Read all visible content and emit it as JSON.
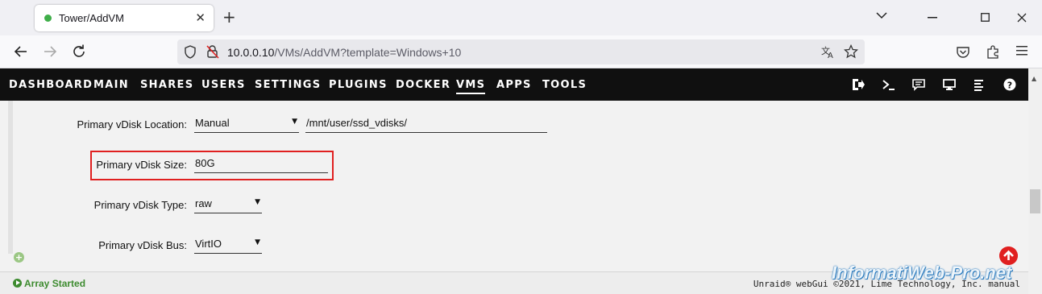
{
  "browser": {
    "tab_title": "Tower/AddVM",
    "tab_close": "✕",
    "new_tab": "+",
    "url_host": "10.0.0.10",
    "url_rest": "/VMs/AddVM?template=Windows+10"
  },
  "nav": {
    "menu": [
      "DASHBOARD",
      "MAIN",
      "SHARES",
      "USERS",
      "SETTINGS",
      "PLUGINS",
      "DOCKER",
      "VMS",
      "APPS",
      "TOOLS"
    ],
    "active": "VMS"
  },
  "form": {
    "location_label": "Primary vDisk Location:",
    "location_value": "Manual",
    "location_path": "/mnt/user/ssd_vdisks/",
    "size_label": "Primary vDisk Size:",
    "size_value": "80G",
    "type_label": "Primary vDisk Type:",
    "type_value": "raw",
    "bus_label": "Primary vDisk Bus:",
    "bus_value": "VirtIO"
  },
  "status": {
    "left": "Array Started",
    "right": "Unraid® webGui ©2021, Lime Technology, Inc. manual"
  },
  "watermark": "InformatiWeb-Pro.net",
  "colors": {
    "header_bg": "#101010",
    "highlight": "#e02020",
    "status_green": "#3d8b2f"
  }
}
